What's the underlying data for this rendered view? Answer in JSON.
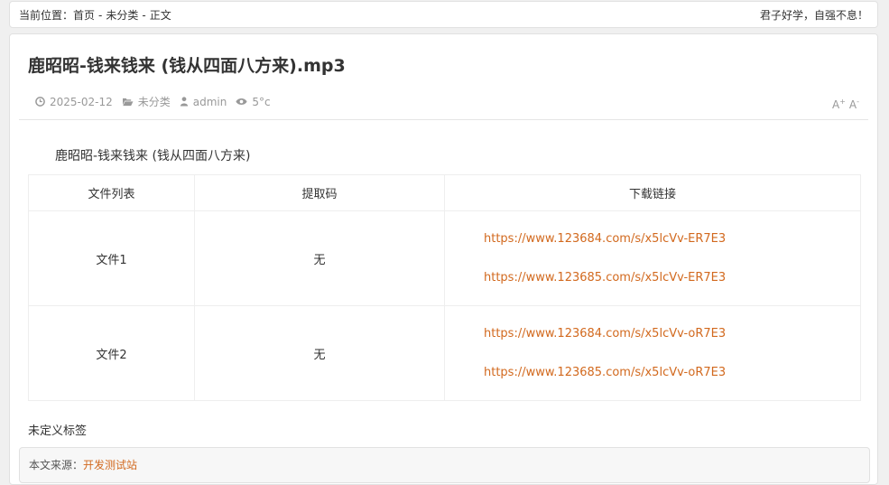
{
  "breadcrumb": {
    "prefix": "当前位置：",
    "home": "首页",
    "category": "未分类",
    "current": "正文",
    "separator": "-"
  },
  "motto": "君子好学，自强不息！",
  "article": {
    "title": "鹿昭昭-钱来钱来 (钱从四面八方来).mp3",
    "date": "2025-02-12",
    "category": "未分类",
    "author": "admin",
    "views": "5°c",
    "font_increase": "A",
    "font_increase_sup": "+",
    "font_decrease": "A",
    "font_decrease_sup": "-",
    "intro": "鹿昭昭-钱来钱来 (钱从四面八方来)"
  },
  "table": {
    "headers": [
      "文件列表",
      "提取码",
      "下载链接"
    ],
    "rows": [
      {
        "name": "文件1",
        "code": "无",
        "links": [
          "https://www.123684.com/s/x5lcVv-ER7E3",
          "https://www.123685.com/s/x5lcVv-ER7E3"
        ]
      },
      {
        "name": "文件2",
        "code": "无",
        "links": [
          "https://www.123684.com/s/x5lcVv-oR7E3",
          "https://www.123685.com/s/x5lcVv-oR7E3"
        ]
      }
    ]
  },
  "tags_text": "未定义标签",
  "source": {
    "label": "本文来源：",
    "site": "开发测试站"
  },
  "colors": {
    "link": "#d2691e",
    "meta": "#999999"
  }
}
